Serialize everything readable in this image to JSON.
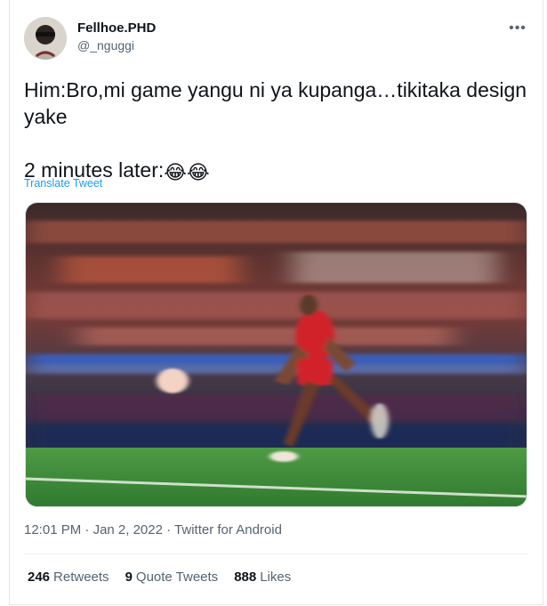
{
  "user": {
    "display_name": "Fellhoe.PHD",
    "handle": "@_nguggi"
  },
  "tweet": {
    "line1": "Him:Bro,mi game yangu ni ya kupanga…tikitaka design yake",
    "line2": "2 minutes later:",
    "emojis": [
      "😂",
      "😂"
    ],
    "translate_label": "Translate Tweet"
  },
  "meta": {
    "time": "12:01 PM",
    "date": "Jan 2, 2022",
    "source": "Twitter for Android",
    "separator": " · "
  },
  "stats": {
    "retweets_count": "246",
    "retweets_label": "Retweets",
    "quotes_count": "9",
    "quotes_label": "Quote Tweets",
    "likes_count": "888",
    "likes_label": "Likes"
  },
  "icons": {
    "more": "more-options-icon",
    "emoji": "face-with-tears-of-joy-icon"
  },
  "colors": {
    "link": "#1d9bf0",
    "secondary_text": "#536471",
    "primary_text": "#0f1419",
    "jersey_red": "#d1222c",
    "pitch_green": "#3d8a3a"
  }
}
